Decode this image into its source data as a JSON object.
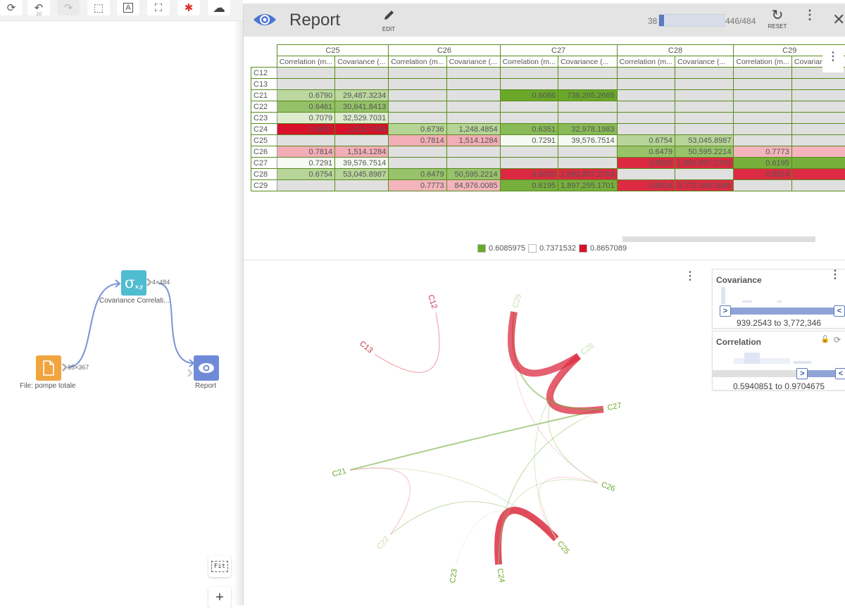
{
  "toolbar": {
    "buttons": [
      {
        "name": "refresh",
        "glyph": "⟳"
      },
      {
        "name": "undo",
        "glyph": "↶",
        "sub": "10"
      },
      {
        "name": "redo",
        "glyph": "↷"
      },
      {
        "name": "select",
        "glyph": "⬚"
      },
      {
        "name": "text-annotation",
        "glyph": "A"
      },
      {
        "name": "fullscreen",
        "glyph": "⛶"
      },
      {
        "name": "debug",
        "glyph": "✱"
      },
      {
        "name": "download",
        "glyph": "☁"
      }
    ]
  },
  "workflow": {
    "nodes": {
      "file": {
        "label": "File: pompe totale",
        "dims": "35×367",
        "color": "#f0a540"
      },
      "cov": {
        "label": "Covariance Correlati...",
        "dims": "4×484",
        "color": "#4fbcd0",
        "glyph": "σ",
        "sub": "x,y"
      },
      "report": {
        "label": "Report",
        "color": "#6f8ad8"
      }
    },
    "fit_label": "Fit",
    "zoom_in": "+"
  },
  "report": {
    "title": "Report",
    "edit_label": "EDIT",
    "progress": {
      "low": "38",
      "high": "446/484",
      "fraction": 0.078
    },
    "reset_label": "RESET",
    "close": "✕",
    "more": "⋮"
  },
  "table": {
    "groups": [
      "C25",
      "C26",
      "C27",
      "C28",
      "C29"
    ],
    "sub_headers": [
      "Correlation (m...",
      "Covariance (..."
    ],
    "rows": [
      {
        "label": "C12",
        "cells": [
          [
            "",
            ""
          ],
          [
            "",
            ""
          ],
          [
            "",
            ""
          ],
          [
            "",
            ""
          ],
          [
            "",
            ""
          ]
        ]
      },
      {
        "label": "C13",
        "cells": [
          [
            "",
            ""
          ],
          [
            "",
            ""
          ],
          [
            "",
            ""
          ],
          [
            "",
            ""
          ],
          [
            "",
            ""
          ]
        ]
      },
      {
        "label": "C21",
        "cells": [
          [
            "0.6790",
            "29,487.3234"
          ],
          [
            "",
            ""
          ],
          [
            "0.6086",
            "736,265.2665"
          ],
          [
            "",
            ""
          ],
          [
            "",
            ""
          ]
        ]
      },
      {
        "label": "C22",
        "cells": [
          [
            "0.6461",
            "30,641.8413"
          ],
          [
            "",
            ""
          ],
          [
            "",
            ""
          ],
          [
            "",
            ""
          ],
          [
            "",
            ""
          ]
        ]
      },
      {
        "label": "C23",
        "cells": [
          [
            "0.7079",
            "32,529.7031"
          ],
          [
            "",
            ""
          ],
          [
            "",
            ""
          ],
          [
            "",
            ""
          ],
          [
            "",
            ""
          ]
        ]
      },
      {
        "label": "C24",
        "cells": [
          [
            "0.8657",
            "1,613.7048"
          ],
          [
            "0.6736",
            "1,248.4854"
          ],
          [
            "0.6351",
            "32,978.1983"
          ],
          [
            "",
            ""
          ],
          [
            "",
            ""
          ]
        ]
      },
      {
        "label": "C25",
        "cells": [
          [
            "",
            ""
          ],
          [
            "0.7814",
            "1,514.1284"
          ],
          [
            "0.7291",
            "39,576.7514"
          ],
          [
            "0.6754",
            "53,045.8987"
          ],
          [
            "",
            ""
          ]
        ]
      },
      {
        "label": "C26",
        "cells": [
          [
            "0.7814",
            "1,514.1284"
          ],
          [
            "",
            ""
          ],
          [
            "",
            ""
          ],
          [
            "0.6479",
            "50,595.2214"
          ],
          [
            "0.7773",
            ""
          ]
        ]
      },
      {
        "label": "C27",
        "cells": [
          [
            "0.7291",
            "39,576.7514"
          ],
          [
            "",
            ""
          ],
          [
            "",
            ""
          ],
          [
            "0.8520",
            "1,863,857.2763"
          ],
          [
            "0.6195",
            ""
          ]
        ]
      },
      {
        "label": "C28",
        "cells": [
          [
            "0.6754",
            "53,045.8987"
          ],
          [
            "0.6479",
            "50,595.2214"
          ],
          [
            "0.8520",
            "1,863,857.2763"
          ],
          [
            "",
            ""
          ],
          [
            "0.8514",
            ""
          ]
        ]
      },
      {
        "label": "C29",
        "cells": [
          [
            "",
            ""
          ],
          [
            "0.7773",
            "84,976.0085"
          ],
          [
            "0.6195",
            "1,897,255.1701"
          ],
          [
            "0.8514",
            "3,772,346.2046"
          ],
          [
            "",
            ""
          ]
        ]
      }
    ],
    "legend": [
      {
        "label": "0.6085975",
        "color": "#6aa82a"
      },
      {
        "label": "0.7371532",
        "color": "#ffffff"
      },
      {
        "label": "0.8657089",
        "color": "#d8102a"
      }
    ],
    "empty_color": "#e0e0e0"
  },
  "chord": {
    "nodes": [
      "C12",
      "C13",
      "C21",
      "C22",
      "C23",
      "C24",
      "C25",
      "C26",
      "C27",
      "C28",
      "C29"
    ],
    "links": [
      {
        "a": "C12",
        "b": "C13",
        "corr": 0.84
      },
      {
        "a": "C21",
        "b": "C25",
        "corr": 0.679
      },
      {
        "a": "C22",
        "b": "C25",
        "corr": 0.6461
      },
      {
        "a": "C23",
        "b": "C25",
        "corr": 0.7079
      },
      {
        "a": "C21",
        "b": "C27",
        "corr": 0.6086
      },
      {
        "a": "C24",
        "b": "C25",
        "corr": 0.8657
      },
      {
        "a": "C24",
        "b": "C26",
        "corr": 0.6736
      },
      {
        "a": "C24",
        "b": "C27",
        "corr": 0.6351
      },
      {
        "a": "C25",
        "b": "C26",
        "corr": 0.7814
      },
      {
        "a": "C25",
        "b": "C27",
        "corr": 0.7291
      },
      {
        "a": "C25",
        "b": "C28",
        "corr": 0.6754
      },
      {
        "a": "C26",
        "b": "C28",
        "corr": 0.6479
      },
      {
        "a": "C26",
        "b": "C29",
        "corr": 0.7773
      },
      {
        "a": "C27",
        "b": "C28",
        "corr": 0.852
      },
      {
        "a": "C27",
        "b": "C29",
        "corr": 0.6195
      },
      {
        "a": "C28",
        "b": "C29",
        "corr": 0.8514
      },
      {
        "a": "C21",
        "b": "C22",
        "corr": 0.8
      }
    ]
  },
  "filters": {
    "covariance": {
      "title": "Covariance",
      "range": "939.2543 to 3,772,346",
      "min_frac": 0.0,
      "max_frac": 1.0
    },
    "correlation": {
      "title": "Correlation",
      "range": "0.5940851 to 0.9704675",
      "min_frac": 0.7,
      "max_frac": 1.0
    }
  }
}
